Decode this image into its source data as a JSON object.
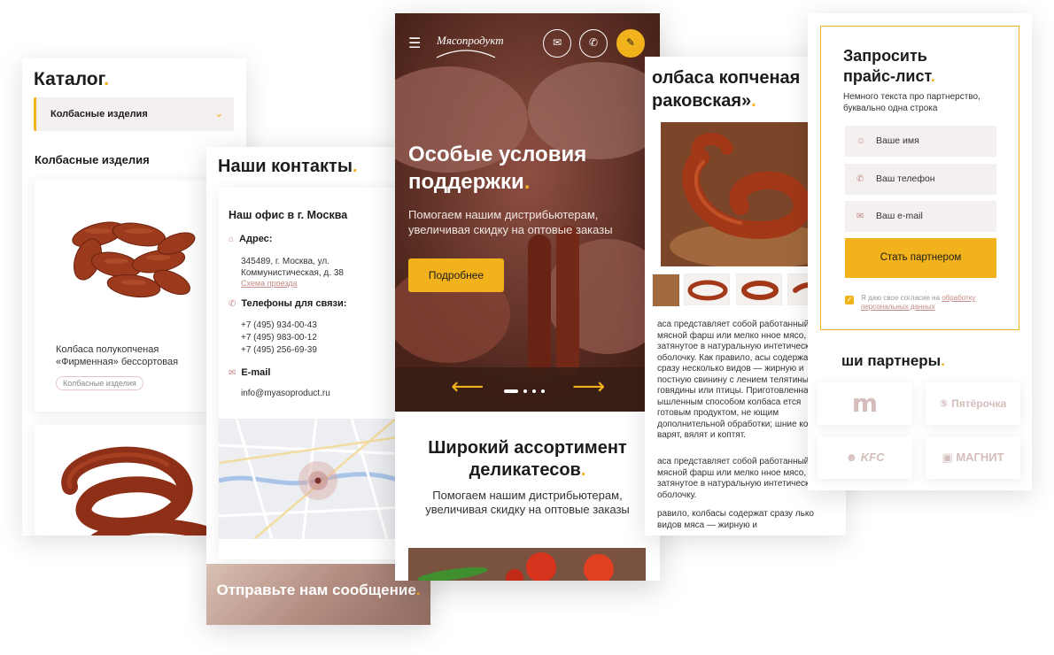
{
  "catalog": {
    "title": "Каталог",
    "select_value": "Колбасные изделия",
    "section_title": "Колбасные изделия",
    "cards": [
      {
        "name": "Колбаса полукопченая «Фирменная» бессортовая",
        "tag": "Колбасные изделия"
      }
    ]
  },
  "contacts": {
    "title": "Наши контакты",
    "office_title": "Наш офис в г. Москва",
    "address_label": "Адрес:",
    "address": "345489, г. Москва, ул. Коммунистическая, д. 38",
    "route_link": "Схема проезда",
    "phones_label": "Телефоны для связи:",
    "phones": [
      "+7 (495) 934-00-43",
      "+7 (495) 983-00-12",
      "+7 (495) 256-69-39"
    ],
    "email_label": "E-mail",
    "email": "info@myasoproduct.ru",
    "message_title": "Отправьте нам сообщение"
  },
  "main": {
    "logo": "Мясопродукт",
    "hero_title": "Особые условия поддержки",
    "hero_subtitle": "Помогаем нашим дистрибьютерам, увеличивая скидку на оптовые заказы",
    "hero_button": "Подробнее",
    "section_title": "Широкий ассортимент деликатесов",
    "section_subtitle": "Помогаем нашим дистрибьютерам, увеличивая скидку на оптовые заказы"
  },
  "product": {
    "title_line1": "олбаса копченая",
    "title_line2": "раковская»",
    "desc1": "аса представляет собой работанный мясной фарш или мелко нное мясо, затянутое в натуральную интетическую оболочку. Как правило, асы содержат сразу несколько видов — жирную и постную свинину с лением телятины, говядины или птицы. Приготовленная ышленным способом колбаса ется готовым продуктом, не ющим дополнительной обработки; шние колбасы варят, вялят и коптят.",
    "desc2": "аса представляет собой работанный мясной фарш или мелко нное мясо, затянутое в натуральную интетическую оболочку.",
    "desc3": "равило, колбасы содержат сразу лько видов мяса — жирную и"
  },
  "price": {
    "title_line1": "Запросить",
    "title_line2": "прайс-лист",
    "subtitle": "Немного текста про партнерство, буквально одна строка",
    "field_name": "Ваше имя",
    "field_phone": "Ваш телефон",
    "field_email": "Ваш e-mail",
    "submit": "Стать партнером",
    "agree_text": "Я даю свое согласие на",
    "agree_link": "обработку персональных данных",
    "partners_title": "ши партнеры",
    "partners": [
      "Пятёрочка",
      "KFC",
      "МАГНИТ"
    ]
  }
}
